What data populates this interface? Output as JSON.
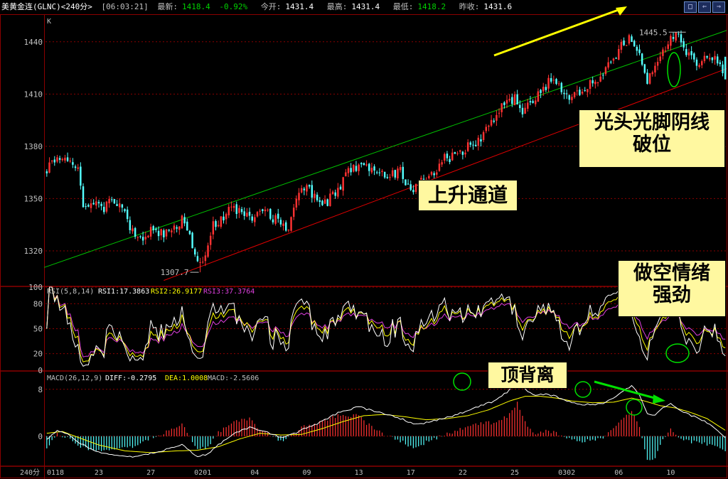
{
  "header": {
    "title": "美黄金连(GLNC)<240分>",
    "time": "[06:03:21]",
    "latest_label": "最新:",
    "latest_value": "1418.4",
    "change": "-0.92%",
    "open_label": "今开:",
    "open_value": "1431.4",
    "high_label": "最高:",
    "high_value": "1431.4",
    "low_label": "最低:",
    "low_value": "1418.2",
    "prevclose_label": "昨收:",
    "prevclose_value": "1431.6"
  },
  "window_buttons": [
    "□",
    "⇐",
    "⇒"
  ],
  "period_label": "240分",
  "colors": {
    "up": "#ff3232",
    "down": "#54ffff",
    "grid": "#8b0000",
    "channel_upper": "#00c000",
    "channel_lower": "#e00000",
    "rsi1": "#ffffff",
    "rsi2": "#ffff00",
    "rsi3": "#e040e0",
    "diff": "#ffffff",
    "dea": "#ffff00",
    "annotation_arrow_yellow": "#ffff00",
    "annotation_arrow_green": "#00e000",
    "circle": "#00e000"
  },
  "chart_data": [
    {
      "type": "candlestick",
      "panel_label": "K",
      "ylim": [
        1300,
        1455
      ],
      "y_ticks": [
        1320,
        1350,
        1380,
        1410,
        1440
      ],
      "x_tick_labels": [
        "0118",
        "23",
        "27",
        "0201",
        "04",
        "09",
        "13",
        "17",
        "22",
        "25",
        "0302",
        "06",
        "10"
      ],
      "close_path": [
        [
          0,
          1366
        ],
        [
          5,
          1375
        ],
        [
          9,
          1372
        ],
        [
          12,
          1368
        ],
        [
          14,
          1345
        ],
        [
          18,
          1348
        ],
        [
          22,
          1345
        ],
        [
          26,
          1350
        ],
        [
          30,
          1340
        ],
        [
          33,
          1330
        ],
        [
          37,
          1327
        ],
        [
          40,
          1332
        ],
        [
          45,
          1330
        ],
        [
          50,
          1333
        ],
        [
          52,
          1340
        ],
        [
          55,
          1330
        ],
        [
          57,
          1318
        ],
        [
          59,
          1313
        ],
        [
          61,
          1320
        ],
        [
          64,
          1335
        ],
        [
          68,
          1340
        ],
        [
          72,
          1345
        ],
        [
          78,
          1338
        ],
        [
          82,
          1345
        ],
        [
          86,
          1340
        ],
        [
          90,
          1336
        ],
        [
          93,
          1332
        ],
        [
          96,
          1350
        ],
        [
          100,
          1356
        ],
        [
          104,
          1350
        ],
        [
          108,
          1348
        ],
        [
          112,
          1356
        ],
        [
          116,
          1365
        ],
        [
          120,
          1369
        ],
        [
          125,
          1366
        ],
        [
          130,
          1363
        ],
        [
          136,
          1366
        ],
        [
          140,
          1355
        ],
        [
          143,
          1358
        ],
        [
          147,
          1362
        ],
        [
          152,
          1372
        ],
        [
          157,
          1375
        ],
        [
          162,
          1380
        ],
        [
          167,
          1385
        ],
        [
          172,
          1395
        ],
        [
          176,
          1405
        ],
        [
          180,
          1408
        ],
        [
          183,
          1400
        ],
        [
          186,
          1405
        ],
        [
          190,
          1412
        ],
        [
          194,
          1418
        ],
        [
          198,
          1412
        ],
        [
          202,
          1408
        ],
        [
          206,
          1413
        ],
        [
          210,
          1418
        ],
        [
          214,
          1420
        ],
        [
          217,
          1428
        ],
        [
          220,
          1436
        ],
        [
          224,
          1442
        ],
        [
          227,
          1437
        ],
        [
          229,
          1428
        ],
        [
          231,
          1418
        ],
        [
          233,
          1420
        ],
        [
          236,
          1432
        ],
        [
          239,
          1440
        ],
        [
          242,
          1445
        ],
        [
          246,
          1432
        ],
        [
          250,
          1428
        ],
        [
          254,
          1432
        ],
        [
          258,
          1430
        ],
        [
          261,
          1422
        ]
      ],
      "annotations": {
        "high_label": "1445.5",
        "low_label": "1307.7"
      }
    },
    {
      "type": "line",
      "panel_label": "RSI(5,8,14)",
      "ylim": [
        0,
        100
      ],
      "y_ticks": [
        0,
        20,
        50,
        80,
        100
      ],
      "series": [
        {
          "name": "RSI1",
          "value_label": "17.3863"
        },
        {
          "name": "RSI2",
          "value_label": "26.9177"
        },
        {
          "name": "RSI3",
          "value_label": "37.3764"
        }
      ]
    },
    {
      "type": "macd",
      "panel_label": "MACD(26,12,9)",
      "ylim": [
        -5,
        11
      ],
      "y_ticks": [
        0,
        8
      ],
      "series": [
        {
          "name": "DIFF",
          "value_label": "-0.2795"
        },
        {
          "name": "DEA",
          "value_label": "1.0008"
        },
        {
          "name": "MACD",
          "value_label": "-2.5606"
        }
      ],
      "diff_path": [
        [
          0,
          -0.5
        ],
        [
          4,
          1
        ],
        [
          8,
          0.3
        ],
        [
          12,
          -1
        ],
        [
          18,
          -2.5
        ],
        [
          26,
          -3.2
        ],
        [
          34,
          -3.5
        ],
        [
          44,
          -2.5
        ],
        [
          52,
          -1.5
        ],
        [
          58,
          -3.5
        ],
        [
          62,
          -3
        ],
        [
          66,
          -1.5
        ],
        [
          72,
          0.5
        ],
        [
          78,
          1.5
        ],
        [
          84,
          0.8
        ],
        [
          90,
          -0.2
        ],
        [
          96,
          0.5
        ],
        [
          100,
          1.5
        ],
        [
          106,
          2.5
        ],
        [
          112,
          4
        ],
        [
          120,
          5
        ],
        [
          128,
          4
        ],
        [
          136,
          3
        ],
        [
          142,
          2
        ],
        [
          148,
          2.5
        ],
        [
          154,
          3.2
        ],
        [
          160,
          4
        ],
        [
          166,
          5
        ],
        [
          172,
          6
        ],
        [
          177,
          7.5
        ],
        [
          181,
          9.2
        ],
        [
          184,
          8
        ],
        [
          188,
          7
        ],
        [
          192,
          7.2
        ],
        [
          196,
          6.8
        ],
        [
          200,
          6
        ],
        [
          204,
          5.5
        ],
        [
          210,
          5.3
        ],
        [
          214,
          5.6
        ],
        [
          218,
          6.5
        ],
        [
          222,
          7.8
        ],
        [
          225,
          8.6
        ],
        [
          228,
          7
        ],
        [
          231,
          4
        ],
        [
          234,
          3.5
        ],
        [
          237,
          4.8
        ],
        [
          240,
          5.5
        ],
        [
          244,
          4.2
        ],
        [
          248,
          3.5
        ],
        [
          252,
          2.8
        ],
        [
          256,
          1.8
        ],
        [
          261,
          -0.3
        ]
      ],
      "dea_path": [
        [
          0,
          0.5
        ],
        [
          6,
          0.8
        ],
        [
          12,
          -0.2
        ],
        [
          20,
          -1.5
        ],
        [
          30,
          -2.5
        ],
        [
          40,
          -2.8
        ],
        [
          50,
          -2.5
        ],
        [
          58,
          -2.4
        ],
        [
          66,
          -1.8
        ],
        [
          74,
          -0.5
        ],
        [
          82,
          0.5
        ],
        [
          90,
          0.2
        ],
        [
          98,
          0.3
        ],
        [
          106,
          1.3
        ],
        [
          114,
          2.5
        ],
        [
          122,
          3.5
        ],
        [
          130,
          3.7
        ],
        [
          138,
          3.3
        ],
        [
          146,
          2.8
        ],
        [
          154,
          3
        ],
        [
          162,
          3.5
        ],
        [
          170,
          4.5
        ],
        [
          178,
          6
        ],
        [
          184,
          6.8
        ],
        [
          190,
          6.8
        ],
        [
          196,
          6.5
        ],
        [
          202,
          6
        ],
        [
          210,
          5.7
        ],
        [
          218,
          5.8
        ],
        [
          225,
          6.5
        ],
        [
          230,
          6
        ],
        [
          236,
          5.2
        ],
        [
          242,
          4.8
        ],
        [
          248,
          4
        ],
        [
          254,
          3
        ],
        [
          261,
          1
        ]
      ]
    }
  ],
  "annotations": {
    "breakdown": [
      "光头光脚阴线",
      "破位"
    ],
    "channel": "上升通道",
    "bearish": [
      "做空情绪",
      "强劲"
    ],
    "divergence": "顶背离"
  }
}
